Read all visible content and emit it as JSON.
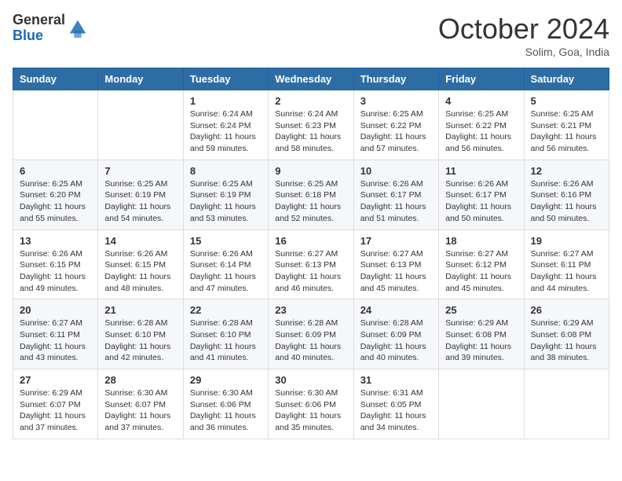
{
  "header": {
    "logo_line1": "General",
    "logo_line2": "Blue",
    "month": "October 2024",
    "location": "Solim, Goa, India"
  },
  "weekdays": [
    "Sunday",
    "Monday",
    "Tuesday",
    "Wednesday",
    "Thursday",
    "Friday",
    "Saturday"
  ],
  "weeks": [
    [
      {
        "day": "",
        "info": ""
      },
      {
        "day": "",
        "info": ""
      },
      {
        "day": "1",
        "info": "Sunrise: 6:24 AM\nSunset: 6:24 PM\nDaylight: 11 hours and 59 minutes."
      },
      {
        "day": "2",
        "info": "Sunrise: 6:24 AM\nSunset: 6:23 PM\nDaylight: 11 hours and 58 minutes."
      },
      {
        "day": "3",
        "info": "Sunrise: 6:25 AM\nSunset: 6:22 PM\nDaylight: 11 hours and 57 minutes."
      },
      {
        "day": "4",
        "info": "Sunrise: 6:25 AM\nSunset: 6:22 PM\nDaylight: 11 hours and 56 minutes."
      },
      {
        "day": "5",
        "info": "Sunrise: 6:25 AM\nSunset: 6:21 PM\nDaylight: 11 hours and 56 minutes."
      }
    ],
    [
      {
        "day": "6",
        "info": "Sunrise: 6:25 AM\nSunset: 6:20 PM\nDaylight: 11 hours and 55 minutes."
      },
      {
        "day": "7",
        "info": "Sunrise: 6:25 AM\nSunset: 6:19 PM\nDaylight: 11 hours and 54 minutes."
      },
      {
        "day": "8",
        "info": "Sunrise: 6:25 AM\nSunset: 6:19 PM\nDaylight: 11 hours and 53 minutes."
      },
      {
        "day": "9",
        "info": "Sunrise: 6:25 AM\nSunset: 6:18 PM\nDaylight: 11 hours and 52 minutes."
      },
      {
        "day": "10",
        "info": "Sunrise: 6:26 AM\nSunset: 6:17 PM\nDaylight: 11 hours and 51 minutes."
      },
      {
        "day": "11",
        "info": "Sunrise: 6:26 AM\nSunset: 6:17 PM\nDaylight: 11 hours and 50 minutes."
      },
      {
        "day": "12",
        "info": "Sunrise: 6:26 AM\nSunset: 6:16 PM\nDaylight: 11 hours and 50 minutes."
      }
    ],
    [
      {
        "day": "13",
        "info": "Sunrise: 6:26 AM\nSunset: 6:15 PM\nDaylight: 11 hours and 49 minutes."
      },
      {
        "day": "14",
        "info": "Sunrise: 6:26 AM\nSunset: 6:15 PM\nDaylight: 11 hours and 48 minutes."
      },
      {
        "day": "15",
        "info": "Sunrise: 6:26 AM\nSunset: 6:14 PM\nDaylight: 11 hours and 47 minutes."
      },
      {
        "day": "16",
        "info": "Sunrise: 6:27 AM\nSunset: 6:13 PM\nDaylight: 11 hours and 46 minutes."
      },
      {
        "day": "17",
        "info": "Sunrise: 6:27 AM\nSunset: 6:13 PM\nDaylight: 11 hours and 45 minutes."
      },
      {
        "day": "18",
        "info": "Sunrise: 6:27 AM\nSunset: 6:12 PM\nDaylight: 11 hours and 45 minutes."
      },
      {
        "day": "19",
        "info": "Sunrise: 6:27 AM\nSunset: 6:11 PM\nDaylight: 11 hours and 44 minutes."
      }
    ],
    [
      {
        "day": "20",
        "info": "Sunrise: 6:27 AM\nSunset: 6:11 PM\nDaylight: 11 hours and 43 minutes."
      },
      {
        "day": "21",
        "info": "Sunrise: 6:28 AM\nSunset: 6:10 PM\nDaylight: 11 hours and 42 minutes."
      },
      {
        "day": "22",
        "info": "Sunrise: 6:28 AM\nSunset: 6:10 PM\nDaylight: 11 hours and 41 minutes."
      },
      {
        "day": "23",
        "info": "Sunrise: 6:28 AM\nSunset: 6:09 PM\nDaylight: 11 hours and 40 minutes."
      },
      {
        "day": "24",
        "info": "Sunrise: 6:28 AM\nSunset: 6:09 PM\nDaylight: 11 hours and 40 minutes."
      },
      {
        "day": "25",
        "info": "Sunrise: 6:29 AM\nSunset: 6:08 PM\nDaylight: 11 hours and 39 minutes."
      },
      {
        "day": "26",
        "info": "Sunrise: 6:29 AM\nSunset: 6:08 PM\nDaylight: 11 hours and 38 minutes."
      }
    ],
    [
      {
        "day": "27",
        "info": "Sunrise: 6:29 AM\nSunset: 6:07 PM\nDaylight: 11 hours and 37 minutes."
      },
      {
        "day": "28",
        "info": "Sunrise: 6:30 AM\nSunset: 6:07 PM\nDaylight: 11 hours and 37 minutes."
      },
      {
        "day": "29",
        "info": "Sunrise: 6:30 AM\nSunset: 6:06 PM\nDaylight: 11 hours and 36 minutes."
      },
      {
        "day": "30",
        "info": "Sunrise: 6:30 AM\nSunset: 6:06 PM\nDaylight: 11 hours and 35 minutes."
      },
      {
        "day": "31",
        "info": "Sunrise: 6:31 AM\nSunset: 6:05 PM\nDaylight: 11 hours and 34 minutes."
      },
      {
        "day": "",
        "info": ""
      },
      {
        "day": "",
        "info": ""
      }
    ]
  ]
}
